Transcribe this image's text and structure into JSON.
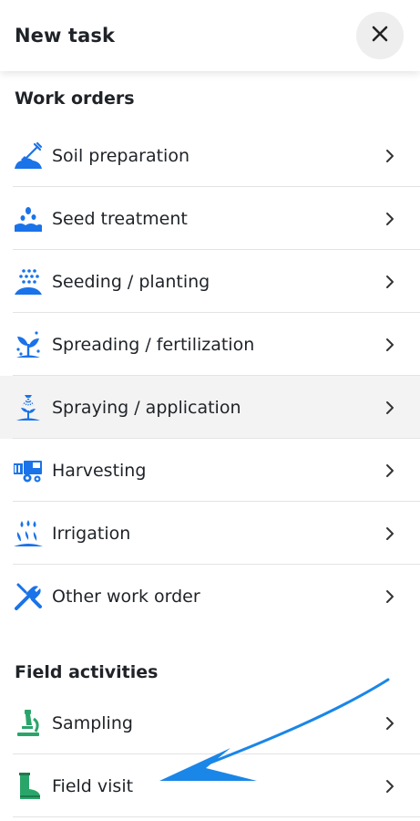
{
  "header": {
    "title": "New task"
  },
  "colors": {
    "work_order_icon": "#1a73e8",
    "field_activity_icon": "#2aa56a",
    "annotation_arrow": "#1a86e8"
  },
  "work_orders": {
    "title": "Work orders",
    "items": [
      {
        "label": "Soil preparation",
        "icon": "shovel-icon"
      },
      {
        "label": "Seed treatment",
        "icon": "seed-treatment-icon"
      },
      {
        "label": "Seeding / planting",
        "icon": "seeding-icon"
      },
      {
        "label": "Spreading / fertilization",
        "icon": "spreading-icon"
      },
      {
        "label": "Spraying / application",
        "icon": "spraying-icon"
      },
      {
        "label": "Harvesting",
        "icon": "harvester-icon"
      },
      {
        "label": "Irrigation",
        "icon": "irrigation-icon"
      },
      {
        "label": "Other work order",
        "icon": "tools-icon"
      }
    ]
  },
  "field_activities": {
    "title": "Field activities",
    "items": [
      {
        "label": "Sampling",
        "icon": "microscope-icon"
      },
      {
        "label": "Field visit",
        "icon": "boot-icon"
      }
    ]
  }
}
